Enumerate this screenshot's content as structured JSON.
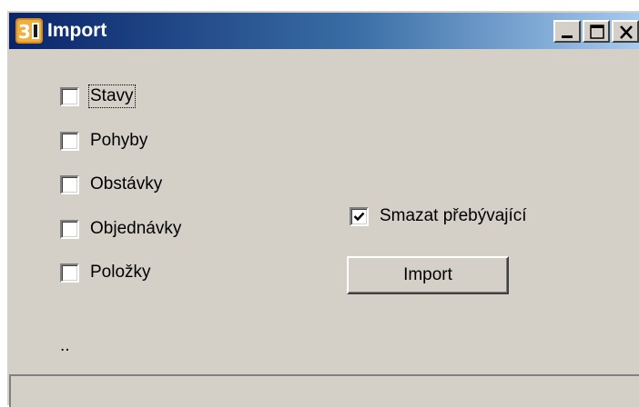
{
  "window": {
    "title": "Import",
    "icon": "app-logo-icon",
    "controls": [
      "minimize-icon",
      "maximize-icon",
      "close-icon"
    ]
  },
  "checkboxes": [
    {
      "label": "Stavy",
      "checked": false,
      "focused": true
    },
    {
      "label": "Pohyby",
      "checked": false
    },
    {
      "label": "Obstávky",
      "checked": false
    },
    {
      "label": "Objednávky",
      "checked": false
    },
    {
      "label": "Položky",
      "checked": false
    }
  ],
  "options": {
    "delete_surplus": {
      "label": "Smazat přebývající",
      "checked": true
    }
  },
  "actions": {
    "import_label": "Import"
  },
  "status": {
    "text": ".."
  },
  "colors": {
    "face": "#d4d0c8",
    "title_start": "#0a246a",
    "title_end": "#a6caf0"
  }
}
